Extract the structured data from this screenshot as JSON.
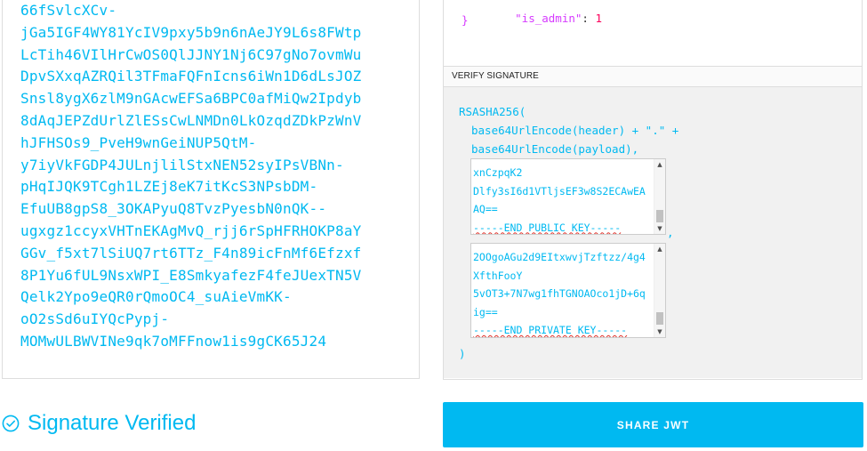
{
  "encoded": {
    "lines": [
      "66fSvlcXCv-",
      "jGa5IGF4WY81YcIV9pxy5b9n6nAeJY9L6s8FWtp",
      "LcTih46VIlHrCwOS0QlJJNY1Nj6C97gNo7ovmWu",
      "DpvSXxqAZRQil3TFmaFQFnIcns6iWn1D6dLsJOZ",
      "Snsl8ygX6zlM9nGAcwEFSa6BPC0afMiQw2Ipdyb",
      "8dAqJEPZdUrlZlESsCwLNMDn0LkOzqdZDkPzWnV",
      "hJFHSOs9_PveH9wnGeiNUP5QtM-",
      "y7iyVkFGDP4JULnjlilStxNEN52syIPsVBNn-",
      "pHqIJQK9TCgh1LZEj8eK7itKcS3NPsbDM-",
      "EfuUB8gpS8_3OKAPyuQ8TvzPyesbN0nQK--",
      "ugxgz1ccyxVHTnEKAgMvQ_rjj6rSpHFRHOKP8aY",
      "GGv_f5xt7lSiUQ7rt6TTz_F4n89icFnMf6Efzxf",
      "8P1Yu6fUL9NsxWPI_E8SmkyafezF4feJUexTN5V",
      "Qelk2Ypo9eQR0rQmoOC4_suAieVmKK-",
      "oO2sSd6uIYQcPypj-",
      "MOMwULBWVINe9qk7oMFFnow1is9gCK65J24"
    ]
  },
  "payload": {
    "key": "\"is_admin\"",
    "colon": ": ",
    "value": "1",
    "close_brace": "}"
  },
  "verify": {
    "title": "VERIFY SIGNATURE",
    "algo_line": "RSASHA256(",
    "header_line": "base64UrlEncode(header) + \".\" +",
    "payload_line": "base64UrlEncode(payload),",
    "comma": ",",
    "close_paren": ")",
    "public_key": {
      "lines": [
        "xnCzpqK2",
        "Dlfy3sI6d1VTljsEF3w8S2ECAwEA",
        "AQ=="
      ],
      "end": "-----END PUBLIC KEY-----"
    },
    "private_key": {
      "lines": [
        "2OOgoAGu2d9EItxwvjTzftzz/4g4",
        "XfthFooY",
        "5vOT3+7N7wg1fhTGNOAOco1jD+6q",
        "ig=="
      ],
      "end": "-----END PRIVATE KEY-----"
    }
  },
  "status": {
    "text": "Signature Verified"
  },
  "share": {
    "label": "SHARE JWT"
  },
  "colors": {
    "accent": "#00b9f1",
    "json_key": "#d63aff",
    "json_value": "#fb015b"
  },
  "icons": {
    "verified": "check-circle-icon"
  }
}
